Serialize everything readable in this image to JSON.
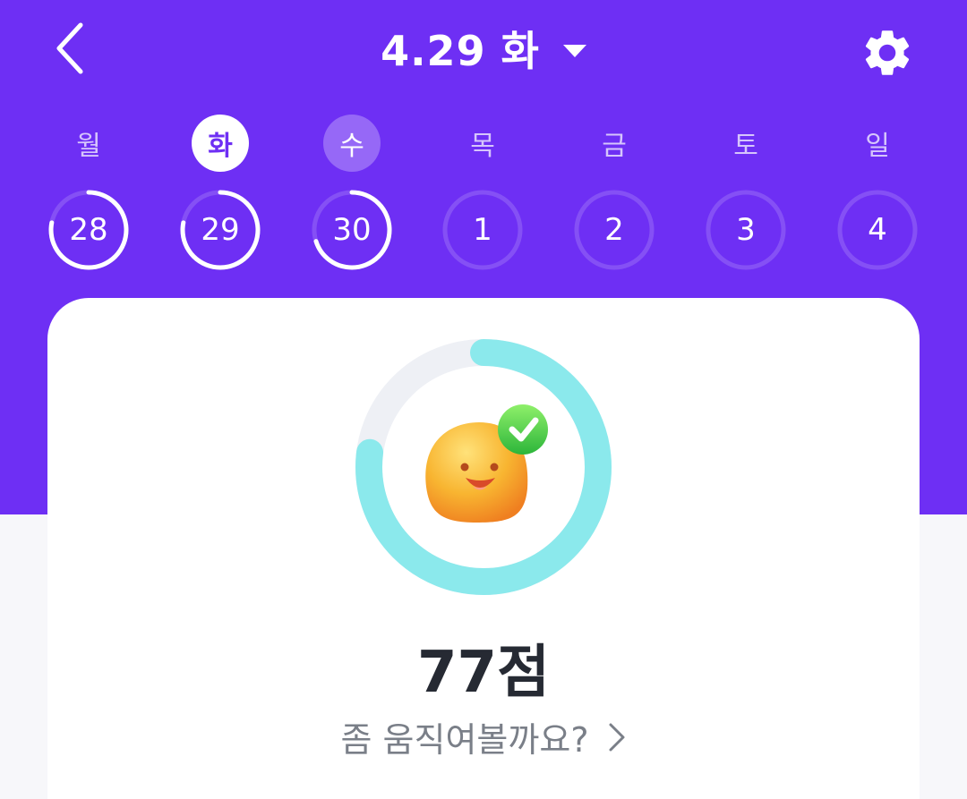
{
  "header": {
    "title": "4.29 화"
  },
  "week": [
    {
      "label": "월",
      "date": "28",
      "progress": 0.78,
      "state": "normal"
    },
    {
      "label": "화",
      "date": "29",
      "progress": 0.78,
      "state": "selected"
    },
    {
      "label": "수",
      "date": "30",
      "progress": 0.7,
      "state": "today"
    },
    {
      "label": "목",
      "date": "1",
      "progress": 0,
      "state": "normal"
    },
    {
      "label": "금",
      "date": "2",
      "progress": 0,
      "state": "normal"
    },
    {
      "label": "토",
      "date": "3",
      "progress": 0,
      "state": "normal"
    },
    {
      "label": "일",
      "date": "4",
      "progress": 0,
      "state": "normal"
    }
  ],
  "score_card": {
    "score_text": "77점",
    "progress": 0.77,
    "message": "좀 움직여볼까요?",
    "mascot_icon": "smiling-blob-mascot-icon",
    "badge_icon": "check-badge-icon"
  },
  "colors": {
    "primary": "#6e2ff4",
    "ring_active": "#8be9ec",
    "ring_track": "#eef0f5",
    "text_dark": "#262a33",
    "text_muted": "#7a7f88"
  }
}
